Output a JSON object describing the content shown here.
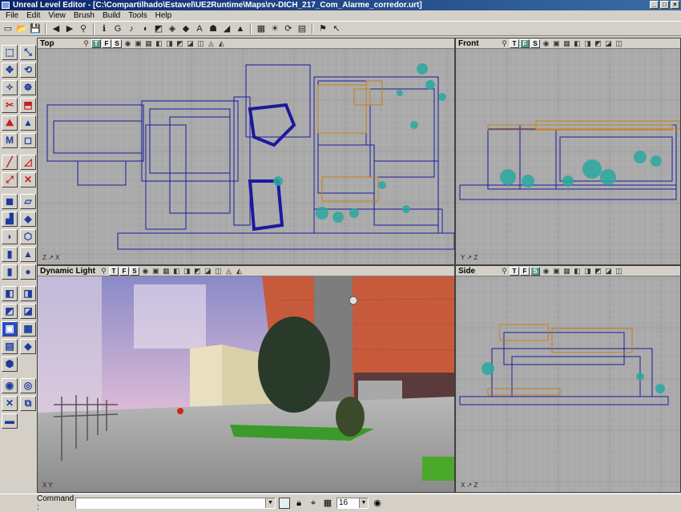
{
  "window": {
    "title": "Unreal Level Editor - [C:\\Compartilhado\\Estavel\\UE2Runtime\\Maps\\rv-DICH_217_Com_Alarme_corredor.urt]",
    "controls": [
      "_",
      "□",
      "×"
    ]
  },
  "menu": [
    "File",
    "Edit",
    "View",
    "Brush",
    "Build",
    "Tools",
    "Help"
  ],
  "toolbar": {
    "icons": [
      "new-icon",
      "open-icon",
      "save-icon",
      "undo-icon",
      "redo-icon",
      "search-icon",
      "actor-browser-icon",
      "group-icon",
      "music-icon",
      "sound-icon",
      "texture-icon",
      "mesh-icon",
      "static-mesh-icon",
      "font-icon",
      "animation-icon",
      "prefab-icon",
      "terrain-icon",
      "build-geometry-icon",
      "build-lighting-icon",
      "build-paths-icon",
      "build-all-icon",
      "play-icon",
      "select-icon"
    ],
    "glyphs": [
      "▭",
      "📂",
      "💾",
      "◀",
      "▶",
      "⚲",
      "ℹ",
      "G",
      "♪",
      "◖",
      "◩",
      "◈",
      "◆",
      "A",
      "☗",
      "◢",
      "▲",
      "▦",
      "☀",
      "⟳",
      "▤",
      "⚑",
      "↖"
    ]
  },
  "sidebar": {
    "groups": [
      {
        "tools": [
          {
            "name": "camera-move-icon",
            "g": "⬚"
          },
          {
            "name": "vertex-edit-icon",
            "g": "⤡"
          },
          {
            "name": "scale-icon",
            "g": "✥"
          },
          {
            "name": "rotate-icon",
            "g": "⟲"
          },
          {
            "name": "texture-pan-icon",
            "g": "✧"
          },
          {
            "name": "texture-rotate-icon",
            "g": "☸"
          },
          {
            "name": "clip-icon",
            "g": "✂"
          },
          {
            "name": "brush-clip-icon",
            "g": "⬒"
          },
          {
            "name": "terrain-edit-icon",
            "g": "⛰"
          },
          {
            "name": "matinee-icon",
            "g": "▲"
          },
          {
            "name": "mod-icon",
            "g": "M"
          },
          {
            "name": "cube-select-icon",
            "g": "◻"
          }
        ]
      },
      {
        "tools": [
          {
            "name": "line-brush-icon",
            "g": "╱"
          },
          {
            "name": "poly-brush-icon",
            "g": "◿"
          },
          {
            "name": "path-icon",
            "g": "⤢"
          },
          {
            "name": "clip-brush-icon",
            "g": "✕"
          }
        ]
      },
      {
        "tools": [
          {
            "name": "cube-builder-icon",
            "g": "◼"
          },
          {
            "name": "sheet-builder-icon",
            "g": "▱"
          },
          {
            "name": "stair-builder-icon",
            "g": "▟"
          },
          {
            "name": "tetra-builder-icon",
            "g": "◆"
          },
          {
            "name": "curved-stair-icon",
            "g": "◗"
          },
          {
            "name": "volumetric-icon",
            "g": "⬡"
          },
          {
            "name": "cylinder-builder-icon",
            "g": "▮"
          },
          {
            "name": "cone-builder-icon",
            "g": "▲"
          },
          {
            "name": "spiral-stair-icon",
            "g": "▮"
          },
          {
            "name": "sphere-builder-icon",
            "g": "●"
          }
        ]
      },
      {
        "tools": [
          {
            "name": "add-brush-icon",
            "g": "◧"
          },
          {
            "name": "subtract-brush-icon",
            "g": "◨"
          },
          {
            "name": "intersect-icon",
            "g": "◩"
          },
          {
            "name": "deintersect-icon",
            "g": "◪"
          },
          {
            "name": "add-mover-icon",
            "g": "▣"
          },
          {
            "name": "add-special-icon",
            "g": "▩"
          },
          {
            "name": "add-volume-icon",
            "g": "▤"
          },
          {
            "name": "antiportal-icon",
            "g": "◆"
          },
          {
            "name": "show-selected-icon",
            "g": "⬢"
          }
        ]
      },
      {
        "tools": [
          {
            "name": "hide-selected-icon",
            "g": "◉"
          },
          {
            "name": "select-invert-icon",
            "g": "◎"
          },
          {
            "name": "show-all-icon",
            "g": "✕"
          },
          {
            "name": "camera-speed-icon",
            "g": "⧉"
          },
          {
            "name": "misc-icon",
            "g": "▬"
          }
        ]
      }
    ]
  },
  "viewports": [
    {
      "id": "top",
      "label": "Top",
      "modes": [
        "T",
        "F",
        "S"
      ],
      "active": 0,
      "axis": "Z ↗ X"
    },
    {
      "id": "front",
      "label": "Front",
      "modes": [
        "T",
        "F",
        "S"
      ],
      "active": 1,
      "axis": "Y ↗ Z"
    },
    {
      "id": "persp",
      "label": "Dynamic Light",
      "modes": [
        "T",
        "F",
        "S"
      ],
      "active": -1,
      "axis": "X Y"
    },
    {
      "id": "side",
      "label": "Side",
      "modes": [
        "T",
        "F",
        "S"
      ],
      "active": 2,
      "axis": "X ↗ Z"
    }
  ],
  "viewport_icons": [
    "eye-icon",
    "wireframe-icon",
    "zone-icon",
    "texture-icon",
    "lit-icon",
    "dynamic-light-icon",
    "unlit-icon",
    "depth-icon",
    "realtime-icon",
    "lock-icon"
  ],
  "status": {
    "command_label": "Command :",
    "command_value": "",
    "grid_value": "16"
  },
  "colors": {
    "grid_bg": "#a9a9a9",
    "grid_line": "#b8b8b8",
    "grid_major": "#959595",
    "wall": "#1a1aa0",
    "accent_brush": "#c8801a",
    "foliage": "#2aa8a0"
  }
}
